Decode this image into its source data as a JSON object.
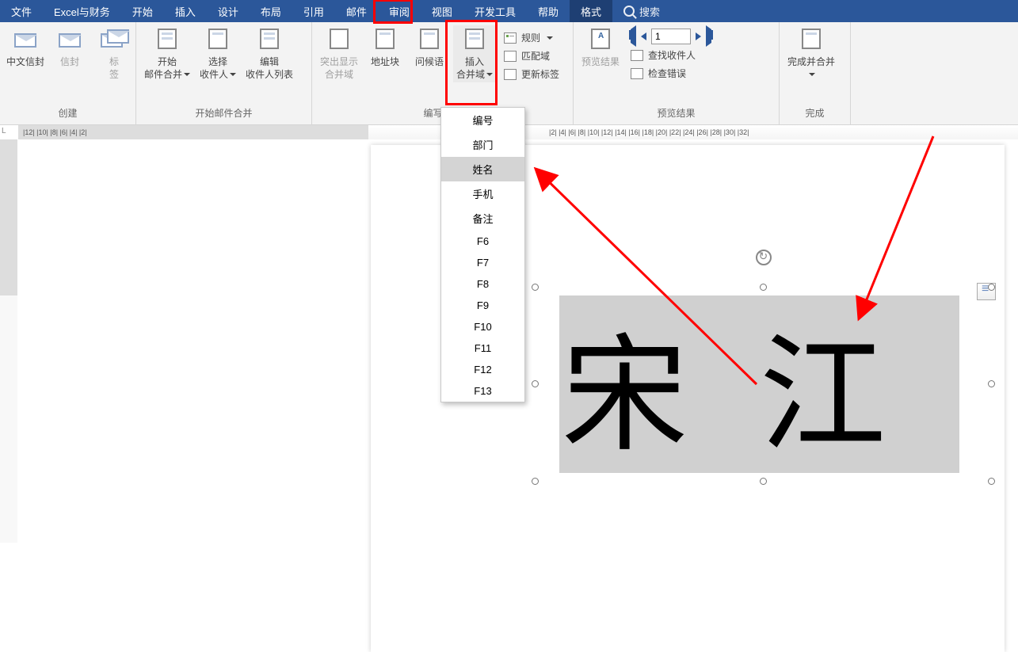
{
  "tabs": [
    "文件",
    "Excel与财务",
    "开始",
    "插入",
    "设计",
    "布局",
    "引用",
    "邮件",
    "审阅",
    "视图",
    "开发工具",
    "帮助",
    "格式"
  ],
  "search_placeholder": "搜索",
  "ribbon": {
    "create": {
      "label": "创建",
      "cn_env": "中文信封",
      "env": "信封",
      "tag": "标\n签"
    },
    "start_merge": {
      "label": "开始邮件合并",
      "start": "开始\n邮件合并",
      "select": "选择\n收件人",
      "edit": "编辑\n收件人列表"
    },
    "write": {
      "label": "编写和插",
      "highlight": "突出显示\n合并域",
      "addr": "地址块",
      "greet": "问候语",
      "insert": "插入\n合并域"
    },
    "rules": {
      "rules": "规则",
      "match": "匹配域",
      "update": "更新标签"
    },
    "preview": {
      "label": "预览结果",
      "btn": "预览结果",
      "find": "查找收件人",
      "check": "检查错误",
      "record": "1"
    },
    "finish": {
      "label": "完成",
      "btn": "完成并合并"
    }
  },
  "dropdown_items": [
    "编号",
    "部门",
    "姓名",
    "手机",
    "备注",
    "F6",
    "F7",
    "F8",
    "F9",
    "F10",
    "F11",
    "F12",
    "F13"
  ],
  "dropdown_selected_index": 2,
  "textbox_content": "宋江",
  "ruler_h_marks": [
    "|2|",
    "|4|",
    "|6|",
    "|8|",
    "|10|",
    "|12|"
  ],
  "ruler_h_marks_right": [
    "|2|",
    "|4|",
    "|6|",
    "|8|",
    "|10|",
    "|12|",
    "|14|",
    "|16|",
    "|18|",
    "|20|",
    "|22|",
    "|24|",
    "|26|",
    "|28|",
    "|30|",
    "|32|"
  ]
}
